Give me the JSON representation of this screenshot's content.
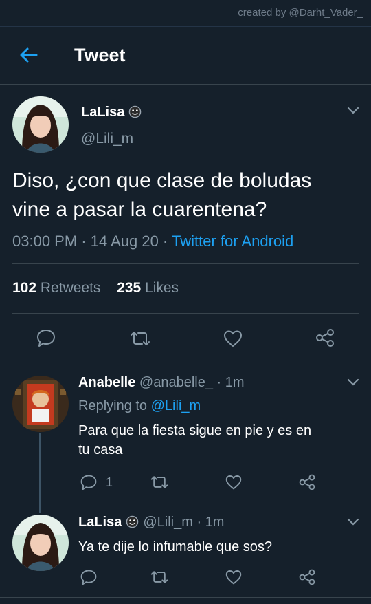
{
  "watermark": "created by @Darht_Vader_",
  "header": {
    "title": "Tweet"
  },
  "main_tweet": {
    "name": "LaLisa",
    "handle": "@Lili_m",
    "text_line1": "Diso, ¿con que clase de boludas",
    "text_line2": "vine a pasar la cuarentena?",
    "time": "03:00 PM · 14 Aug 20 · ",
    "source": "Twitter for Android",
    "retweets_count": "102",
    "retweets_label": "Retweets",
    "likes_count": "235",
    "likes_label": "Likes"
  },
  "replies": [
    {
      "name": "Anabelle",
      "handle": "@anabelle_",
      "time": "· 1m",
      "replying_prefix": "Replying to ",
      "replying_handle": "@Lili_m",
      "text_line1": "Para que la fiesta sigue en pie y es en",
      "text_line2": "tu casa",
      "reply_count": "1"
    },
    {
      "name": "LaLisa",
      "handle": "@Lili_m",
      "time": "· 1m",
      "text_line1": "Ya te dije lo infumable que sos?"
    }
  ],
  "icons": [
    "back-arrow-icon",
    "chevron-down-icon",
    "smiley-icon",
    "reply-icon",
    "retweet-icon",
    "like-icon",
    "share-icon"
  ],
  "colors": {
    "background": "#15202b",
    "accent": "#1da1f2",
    "muted": "#8899a6",
    "divider": "#38444d"
  }
}
